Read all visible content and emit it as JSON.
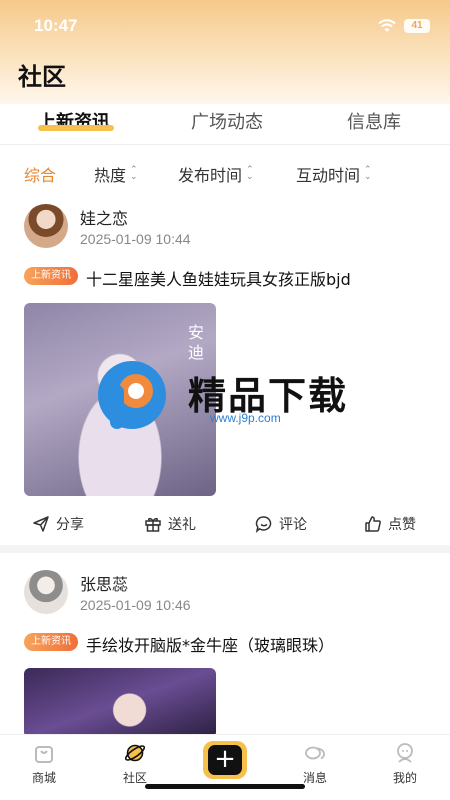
{
  "status_bar": {
    "time": "10:47",
    "battery": "41"
  },
  "page": {
    "title": "社区"
  },
  "tabs": [
    {
      "label": "上新资讯",
      "active": true
    },
    {
      "label": "广场动态",
      "active": false
    },
    {
      "label": "信息库",
      "active": false
    }
  ],
  "filters": [
    {
      "label": "综合",
      "active": true
    },
    {
      "label": "热度"
    },
    {
      "label": "发布时间"
    },
    {
      "label": "互动时间"
    }
  ],
  "posts": [
    {
      "author": "娃之恋",
      "time": "2025-01-09 10:44",
      "tag": "上新资讯",
      "title": "十二星座美人鱼娃娃玩具女孩正版bjd",
      "image_caption": "安\n迪"
    },
    {
      "author": "张思蕊",
      "time": "2025-01-09 10:46",
      "tag": "上新资讯",
      "title": "手绘妆开脑版*金牛座（玻璃眼珠）"
    }
  ],
  "actions": [
    {
      "label": "分享",
      "icon": "share-icon"
    },
    {
      "label": "送礼",
      "icon": "gift-icon"
    },
    {
      "label": "评论",
      "icon": "comment-icon"
    },
    {
      "label": "点赞",
      "icon": "thumbs-up-icon"
    }
  ],
  "watermark": {
    "text": "精品下载",
    "url": "www.j9p.com"
  },
  "bottom_nav": [
    {
      "label": "商城",
      "icon": "shopping-bag-icon"
    },
    {
      "label": "社区",
      "icon": "planet-icon",
      "active": true
    },
    {
      "label": "",
      "icon": "plus-icon"
    },
    {
      "label": "消息",
      "icon": "chat-bubbles-icon"
    },
    {
      "label": "我的",
      "icon": "person-icon"
    }
  ],
  "colors": {
    "accent": "#f5c14a",
    "filter_active": "#e7852f",
    "tag_start": "#f7a35a",
    "tag_end": "#ef6f3a"
  }
}
